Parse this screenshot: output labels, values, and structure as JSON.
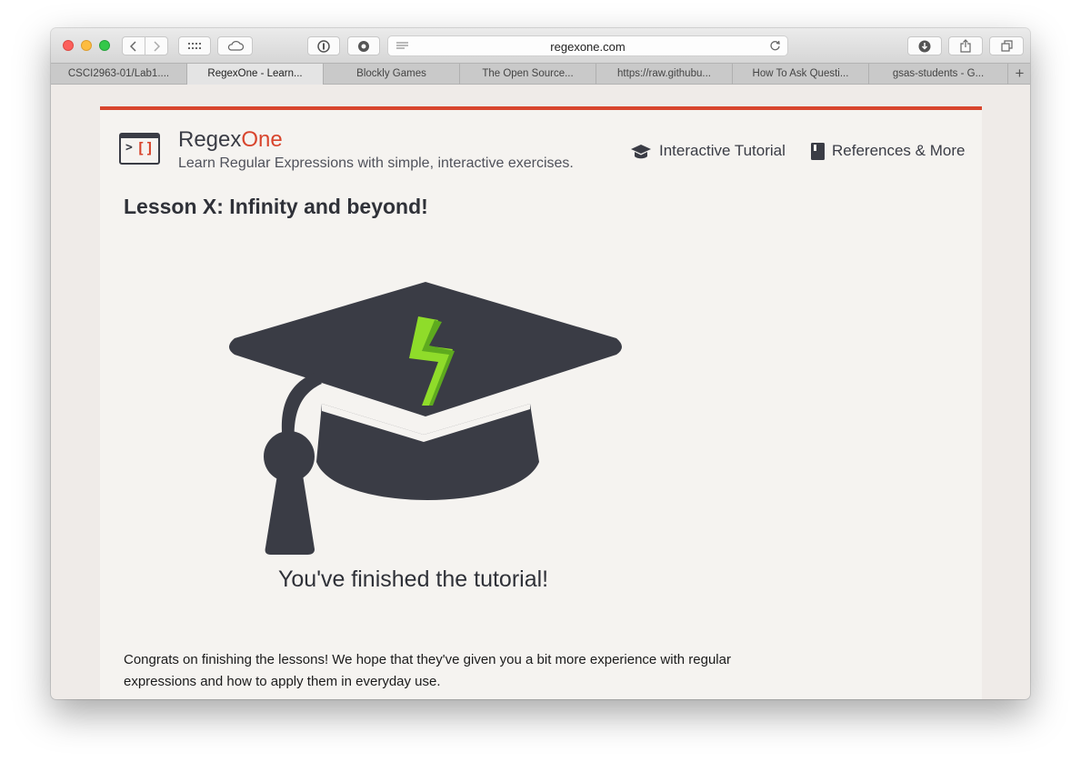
{
  "browser": {
    "url": "regexone.com",
    "tabs": [
      {
        "label": "CSCI2963-01/Lab1....",
        "active": false
      },
      {
        "label": "RegexOne - Learn...",
        "active": true
      },
      {
        "label": "Blockly Games",
        "active": false
      },
      {
        "label": "The Open Source...",
        "active": false
      },
      {
        "label": "https://raw.githubu...",
        "active": false
      },
      {
        "label": "How To Ask Questi...",
        "active": false
      },
      {
        "label": "gsas-students - G...",
        "active": false
      }
    ],
    "new_tab_label": "+"
  },
  "site": {
    "brand_regex": "Regex",
    "brand_one": "One",
    "tagline": "Learn Regular Expressions with simple, interactive exercises.",
    "nav": {
      "tutorial": "Interactive Tutorial",
      "references": "References & More"
    },
    "accent_color": "#d8452d",
    "dark_color": "#3a3c45"
  },
  "lesson": {
    "title": "Lesson X: Infinity and beyond!",
    "finished_text": "You've finished the tutorial!",
    "congrats_text": "Congrats on finishing the lessons! We hope that they've given you a bit more experience with regular expressions and how to apply them in everyday use.",
    "bolt_color": "#8fdc2a"
  }
}
